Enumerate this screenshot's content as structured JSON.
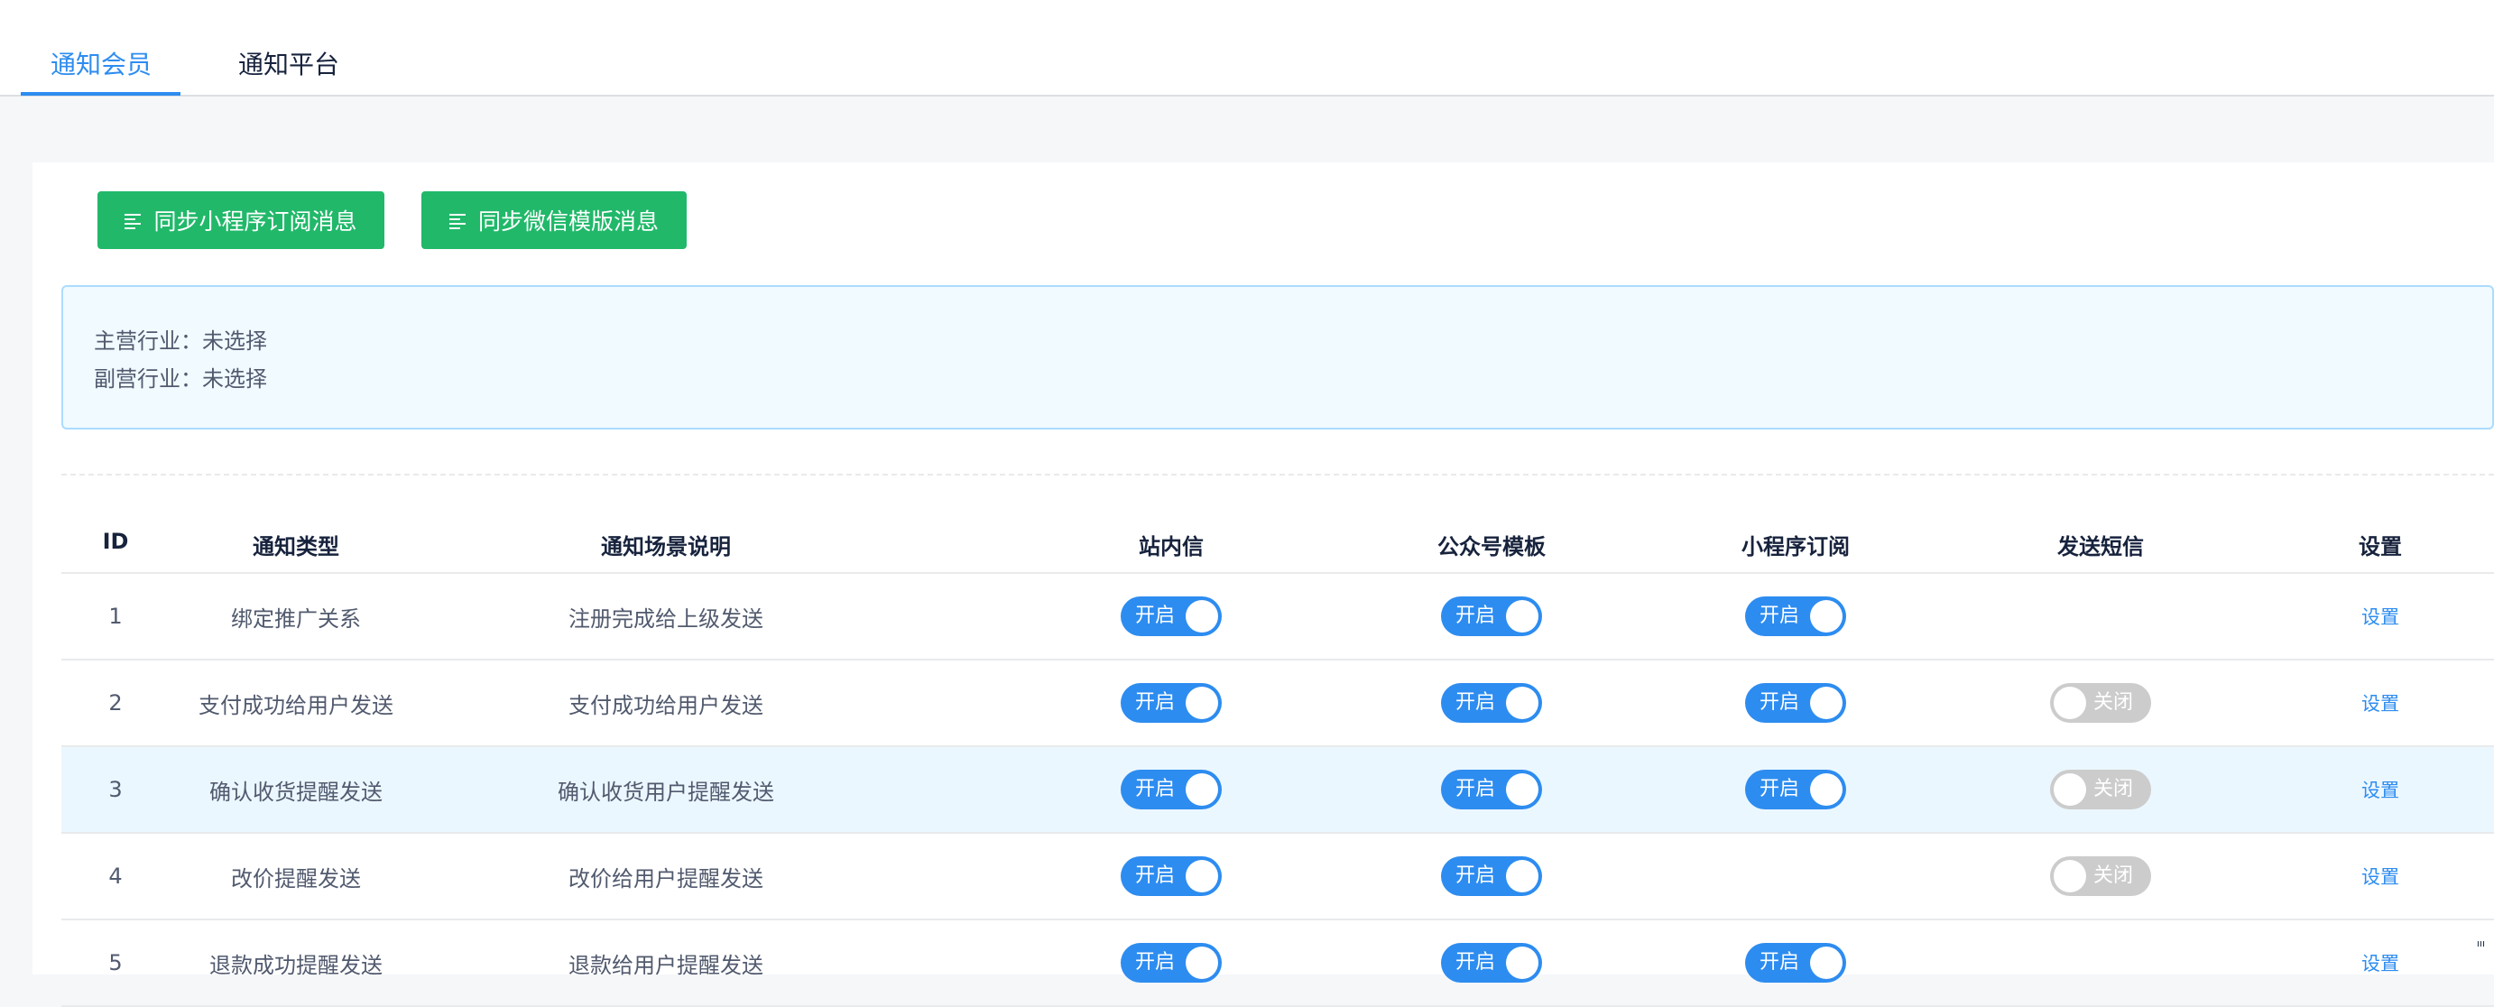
{
  "tabs": [
    {
      "label": "通知会员",
      "active": true
    },
    {
      "label": "通知平台",
      "active": false
    }
  ],
  "toolbar": {
    "sync_miniprogram_label": "同步小程序订阅消息",
    "sync_wechat_label": "同步微信模版消息",
    "button_color": "#21b86a"
  },
  "industry": {
    "main": "主营行业：未选择",
    "sub": "副营行业：未选择"
  },
  "table": {
    "headers": [
      "ID",
      "通知类型",
      "通知场景说明",
      "站内信",
      "公众号模板",
      "小程序订阅",
      "发送短信",
      "设置"
    ],
    "switch_on_label": "开启",
    "switch_off_label": "关闭",
    "rows": [
      {
        "id": "1",
        "type": "绑定推广关系",
        "desc": "注册完成给上级发送",
        "site": "on",
        "mp": "on",
        "mini": "on",
        "sms": null,
        "action": "设置"
      },
      {
        "id": "2",
        "type": "支付成功给用户发送",
        "desc": "支付成功给用户发送",
        "site": "on",
        "mp": "on",
        "mini": "on",
        "sms": "off",
        "action": "设置"
      },
      {
        "id": "3",
        "type": "确认收货提醒发送",
        "desc": "确认收货用户提醒发送",
        "site": "on",
        "mp": "on",
        "mini": "on",
        "sms": "off",
        "action": "设置",
        "highlighted": true
      },
      {
        "id": "4",
        "type": "改价提醒发送",
        "desc": "改价给用户提醒发送",
        "site": "on",
        "mp": "on",
        "mini": null,
        "sms": "off",
        "action": "设置"
      },
      {
        "id": "5",
        "type": "退款成功提醒发送",
        "desc": "退款给用户提醒发送",
        "site": "on",
        "mp": "on",
        "mini": "on",
        "sms": null,
        "action": "设置"
      }
    ]
  },
  "colors": {
    "accent": "#2d8cf0",
    "switch_off": "#cccccc",
    "row_highlight": "#ebf7ff",
    "alert_bg": "#f0faff",
    "alert_border": "#abdcff"
  }
}
